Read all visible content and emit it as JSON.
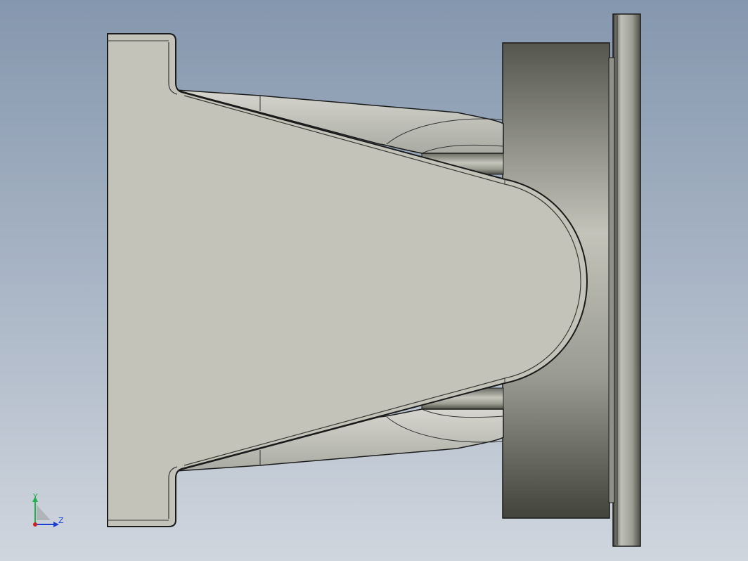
{
  "viewport": {
    "background_top": "#8597ae",
    "background_bottom": "#d0d6de"
  },
  "model": {
    "body_color": "#c3c3ba",
    "edge_color": "#1a1a1a",
    "cylinder_shadow": "#55574e",
    "cylinder_light": "#c8c8bf"
  },
  "triad": {
    "y_label": "Y",
    "z_label": "Z",
    "y_color": "#22b14c",
    "z_color": "#1f3fd0",
    "x_color": "#d02020"
  }
}
